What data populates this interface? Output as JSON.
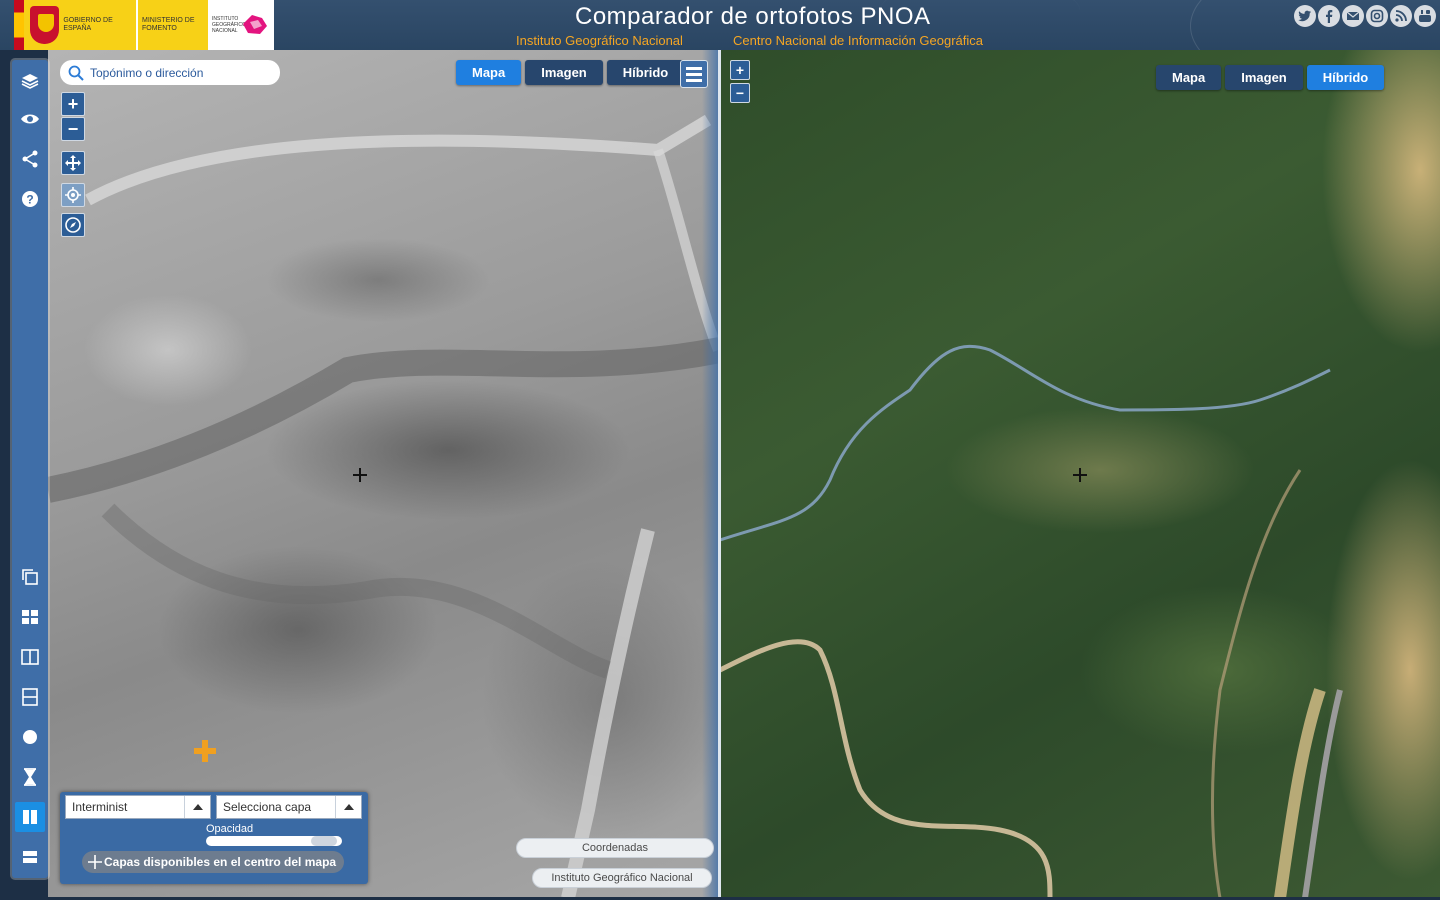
{
  "header": {
    "title": "Comparador de ortofotos PNOA",
    "subtitle_ign": "Instituto Geográfico Nacional",
    "subtitle_cnig": "Centro Nacional de Información Geográfica",
    "logo_gov": "GOBIERNO DE ESPAÑA",
    "logo_ministry": "MINISTERIO DE FOMENTO",
    "logo_ign": "INSTITUTO GEOGRÁFICO NACIONAL",
    "social": [
      "twitter-icon",
      "facebook-icon",
      "email-icon",
      "instagram-icon",
      "rss-icon",
      "youtube-icon"
    ]
  },
  "toolbar": {
    "top_tools": [
      "layers-icon",
      "eye-icon",
      "share-icon",
      "help-icon"
    ],
    "bottom_tools": [
      "copy-layers-icon",
      "four-views-icon",
      "vertical-split-icon",
      "horizontal-split-icon",
      "lens-icon",
      "timeline-icon",
      "split-compare-icon",
      "stack-icon"
    ],
    "active_tool": "split-compare-icon"
  },
  "search": {
    "placeholder": "Topónimo o dirección"
  },
  "left_map": {
    "layers": [
      "Mapa",
      "Imagen",
      "Híbrido"
    ],
    "active_layer": "Mapa",
    "layer_select": "Interminist",
    "compare_select": "Selecciona capa",
    "opacity_label": "Opacidad",
    "opacity_value": 0.95,
    "available_layers_button": "Capas disponibles en el centro del mapa",
    "coordinates_label": "Coordenadas",
    "attribution": "Instituto Geográfico Nacional"
  },
  "right_map": {
    "layers": [
      "Mapa",
      "Imagen",
      "Híbrido"
    ],
    "active_layer": "Híbrido"
  },
  "colors": {
    "accent": "#1f7fe0",
    "toolbar": "#3f6ea8",
    "header": "#2a4562",
    "subtitle": "#f5a623"
  }
}
